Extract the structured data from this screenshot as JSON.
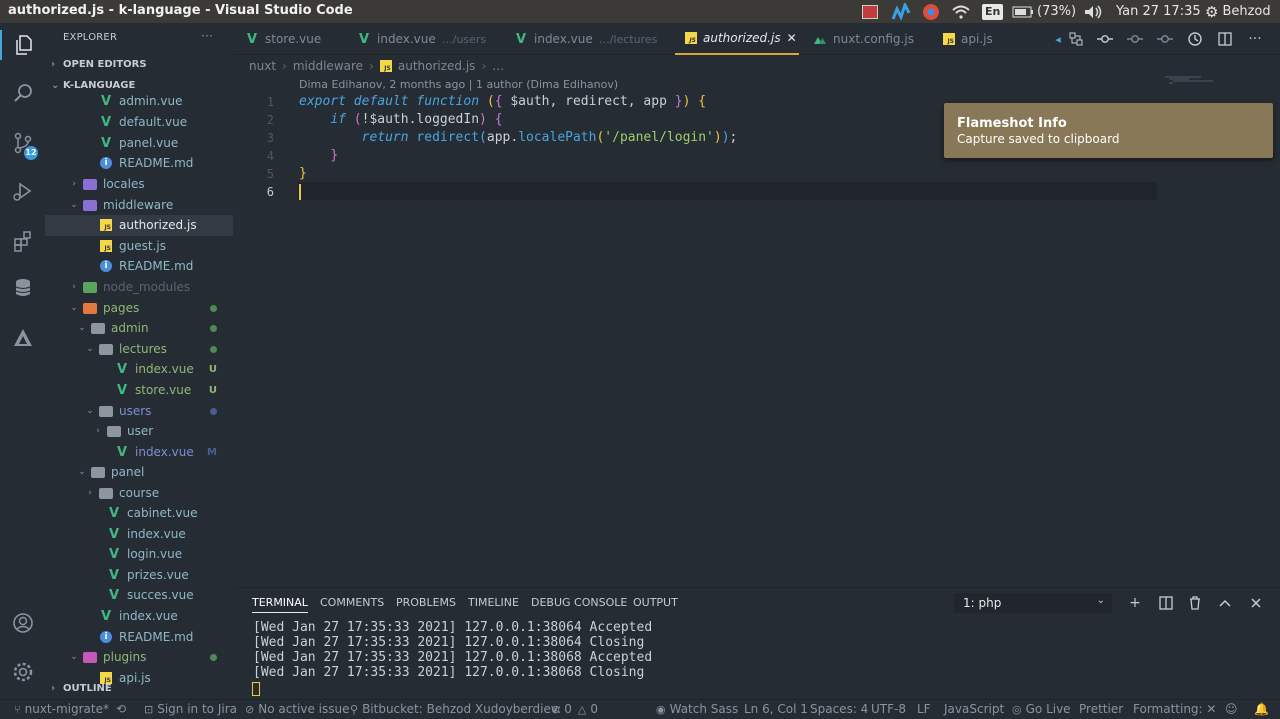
{
  "window": {
    "title": "authorized.js - k-language - Visual Studio Code"
  },
  "system_tray": {
    "language": "En",
    "battery": "(73%)",
    "datetime": "Yan 27 17:35",
    "user": "Behzod"
  },
  "sidebar": {
    "title": "EXPLORER",
    "more": "···",
    "open_editors": "OPEN EDITORS",
    "project": "K-LANGUAGE",
    "outline": "OUTLINE",
    "items": [
      {
        "label": "admin.vue",
        "icon": "vue"
      },
      {
        "label": "default.vue",
        "icon": "vue"
      },
      {
        "label": "panel.vue",
        "icon": "vue"
      },
      {
        "label": "README.md",
        "icon": "info"
      },
      {
        "label": "locales",
        "icon": "folder-purple"
      },
      {
        "label": "middleware",
        "icon": "folder-purple"
      },
      {
        "label": "authorized.js",
        "icon": "js"
      },
      {
        "label": "guest.js",
        "icon": "js"
      },
      {
        "label": "README.md",
        "icon": "info"
      },
      {
        "label": "node_modules",
        "icon": "folder-green"
      },
      {
        "label": "pages",
        "icon": "folder-orange"
      },
      {
        "label": "admin",
        "icon": "folder-grey"
      },
      {
        "label": "lectures",
        "icon": "folder-grey"
      },
      {
        "label": "index.vue",
        "icon": "vue",
        "git": "U"
      },
      {
        "label": "store.vue",
        "icon": "vue",
        "git": "U"
      },
      {
        "label": "users",
        "icon": "folder-grey"
      },
      {
        "label": "user",
        "icon": "folder-grey"
      },
      {
        "label": "index.vue",
        "icon": "vue",
        "git": "M"
      },
      {
        "label": "panel",
        "icon": "folder-grey"
      },
      {
        "label": "course",
        "icon": "folder-grey"
      },
      {
        "label": "cabinet.vue",
        "icon": "vue"
      },
      {
        "label": "index.vue",
        "icon": "vue"
      },
      {
        "label": "login.vue",
        "icon": "vue"
      },
      {
        "label": "prizes.vue",
        "icon": "vue"
      },
      {
        "label": "succes.vue",
        "icon": "vue"
      },
      {
        "label": "index.vue",
        "icon": "vue"
      },
      {
        "label": "README.md",
        "icon": "info"
      },
      {
        "label": "plugins",
        "icon": "folder-pink"
      },
      {
        "label": "api.js",
        "icon": "js"
      }
    ]
  },
  "tabs": [
    {
      "label": "store.vue",
      "desc": "",
      "icon": "vue"
    },
    {
      "label": "index.vue",
      "desc": "…/users",
      "icon": "vue"
    },
    {
      "label": "index.vue",
      "desc": "…/lectures",
      "icon": "vue"
    },
    {
      "label": "authorized.js",
      "desc": "",
      "icon": "js",
      "close": "✕"
    },
    {
      "label": "nuxt.config.js",
      "desc": "",
      "icon": "nuxt"
    },
    {
      "label": "api.js",
      "desc": "",
      "icon": "js"
    }
  ],
  "breadcrumb": {
    "p1": "nuxt",
    "p2": "middleware",
    "p3": "authorized.js",
    "p4": "…"
  },
  "blame": "Dima Edihanov, 2 months ago | 1 author (Dima Edihanov)",
  "code": {
    "line_numbers": [
      "1",
      "2",
      "3",
      "4",
      "5",
      "6"
    ],
    "l1_export": "export",
    "l1_default": "default",
    "l1_function": "function",
    "l1_args": "$auth, redirect, app",
    "l2_if": "if",
    "l2_cond": "!$auth.loggedIn",
    "l3_return": "return",
    "l3_redirect": "redirect",
    "l3_app": "app.",
    "l3_locale": "localePath",
    "l3_str": "'/panel/login'",
    "l3_end": ";"
  },
  "notification": {
    "title": "Flameshot Info",
    "message": "Capture saved to clipboard"
  },
  "panel": {
    "tabs": [
      "TERMINAL",
      "COMMENTS",
      "PROBLEMS",
      "TIMELINE",
      "DEBUG CONSOLE",
      "OUTPUT"
    ],
    "terminal_select": "1: php",
    "lines": [
      "[Wed Jan 27 17:35:33 2021] 127.0.0.1:38064 Accepted",
      "[Wed Jan 27 17:35:33 2021] 127.0.0.1:38064 Closing",
      "[Wed Jan 27 17:35:33 2021] 127.0.0.1:38068 Accepted",
      "[Wed Jan 27 17:35:33 2021] 127.0.0.1:38068 Closing"
    ]
  },
  "statusbar": {
    "branch": "nuxt-migrate*",
    "jira": "Sign in to Jira",
    "issue": "No active issue",
    "bitbucket": "Bitbucket: Behzod Xudoyberdiev:",
    "problems": "0",
    "warnings": "0",
    "watch_sass": "Watch Sass",
    "position": "Ln 6, Col 1",
    "spaces": "Spaces: 4",
    "encoding": "UTF-8",
    "eol": "LF",
    "language": "JavaScript",
    "golive": "Go Live",
    "prettier": "Prettier",
    "formatting": "Formatting: ✕"
  },
  "colors": {
    "accent": "#4aa4e0",
    "vue": "#41b883",
    "js": "#f5d847",
    "notif": "#897858",
    "cursor": "#f0c43e"
  }
}
